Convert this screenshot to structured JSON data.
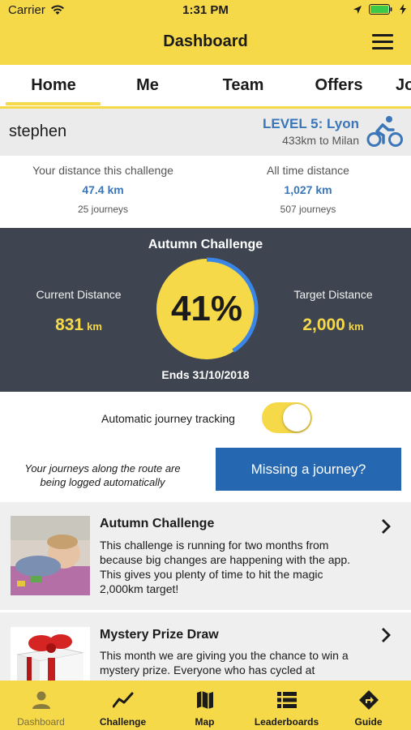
{
  "status_bar": {
    "carrier": "Carrier",
    "time": "1:31 PM"
  },
  "header": {
    "title": "Dashboard"
  },
  "tabs": [
    {
      "label": "Home"
    },
    {
      "label": "Me"
    },
    {
      "label": "Team"
    },
    {
      "label": "Offers"
    },
    {
      "label": "Jo"
    }
  ],
  "profile": {
    "username": "stephen",
    "level": "LEVEL 5: Lyon",
    "next": "433km to Milan"
  },
  "distances": {
    "challenge": {
      "label": "Your distance this challenge",
      "value": "47.4 km",
      "journeys": "25 journeys"
    },
    "alltime": {
      "label": "All time distance",
      "value": "1,027 km",
      "journeys": "507 journeys"
    }
  },
  "challenge": {
    "title": "Autumn Challenge",
    "current_label": "Current Distance",
    "current_value": "831",
    "target_label": "Target Distance",
    "target_value": "2,000",
    "unit": "km",
    "percent_text": "41%",
    "progress": 0.41,
    "ends": "Ends 31/10/2018"
  },
  "tracking": {
    "label": "Automatic journey tracking",
    "enabled": true,
    "note": "Your journeys along the route are being logged automatically",
    "missing_button": "Missing a journey?"
  },
  "cards": [
    {
      "title": "Autumn Challenge",
      "body": "This challenge is running for two months from because big changes are happening with the app. This gives you plenty of time to hit the magic 2,000km target!"
    },
    {
      "title": "Mystery Prize Draw",
      "body": "This month we are giving you the chance to win a mystery prize. Everyone who has cycled at"
    }
  ],
  "bottom_nav": [
    {
      "label": "Dashboard",
      "icon": "person-icon"
    },
    {
      "label": "Challenge",
      "icon": "line-chart-icon"
    },
    {
      "label": "Map",
      "icon": "map-icon"
    },
    {
      "label": "Leaderboards",
      "icon": "list-icon"
    },
    {
      "label": "Guide",
      "icon": "directions-icon"
    }
  ],
  "colors": {
    "brand_yellow": "#f6d949",
    "accent_blue": "#3a76b8",
    "dark_panel": "#3e4550",
    "button_blue": "#2567b0",
    "progress_blue": "#3a86e6"
  }
}
